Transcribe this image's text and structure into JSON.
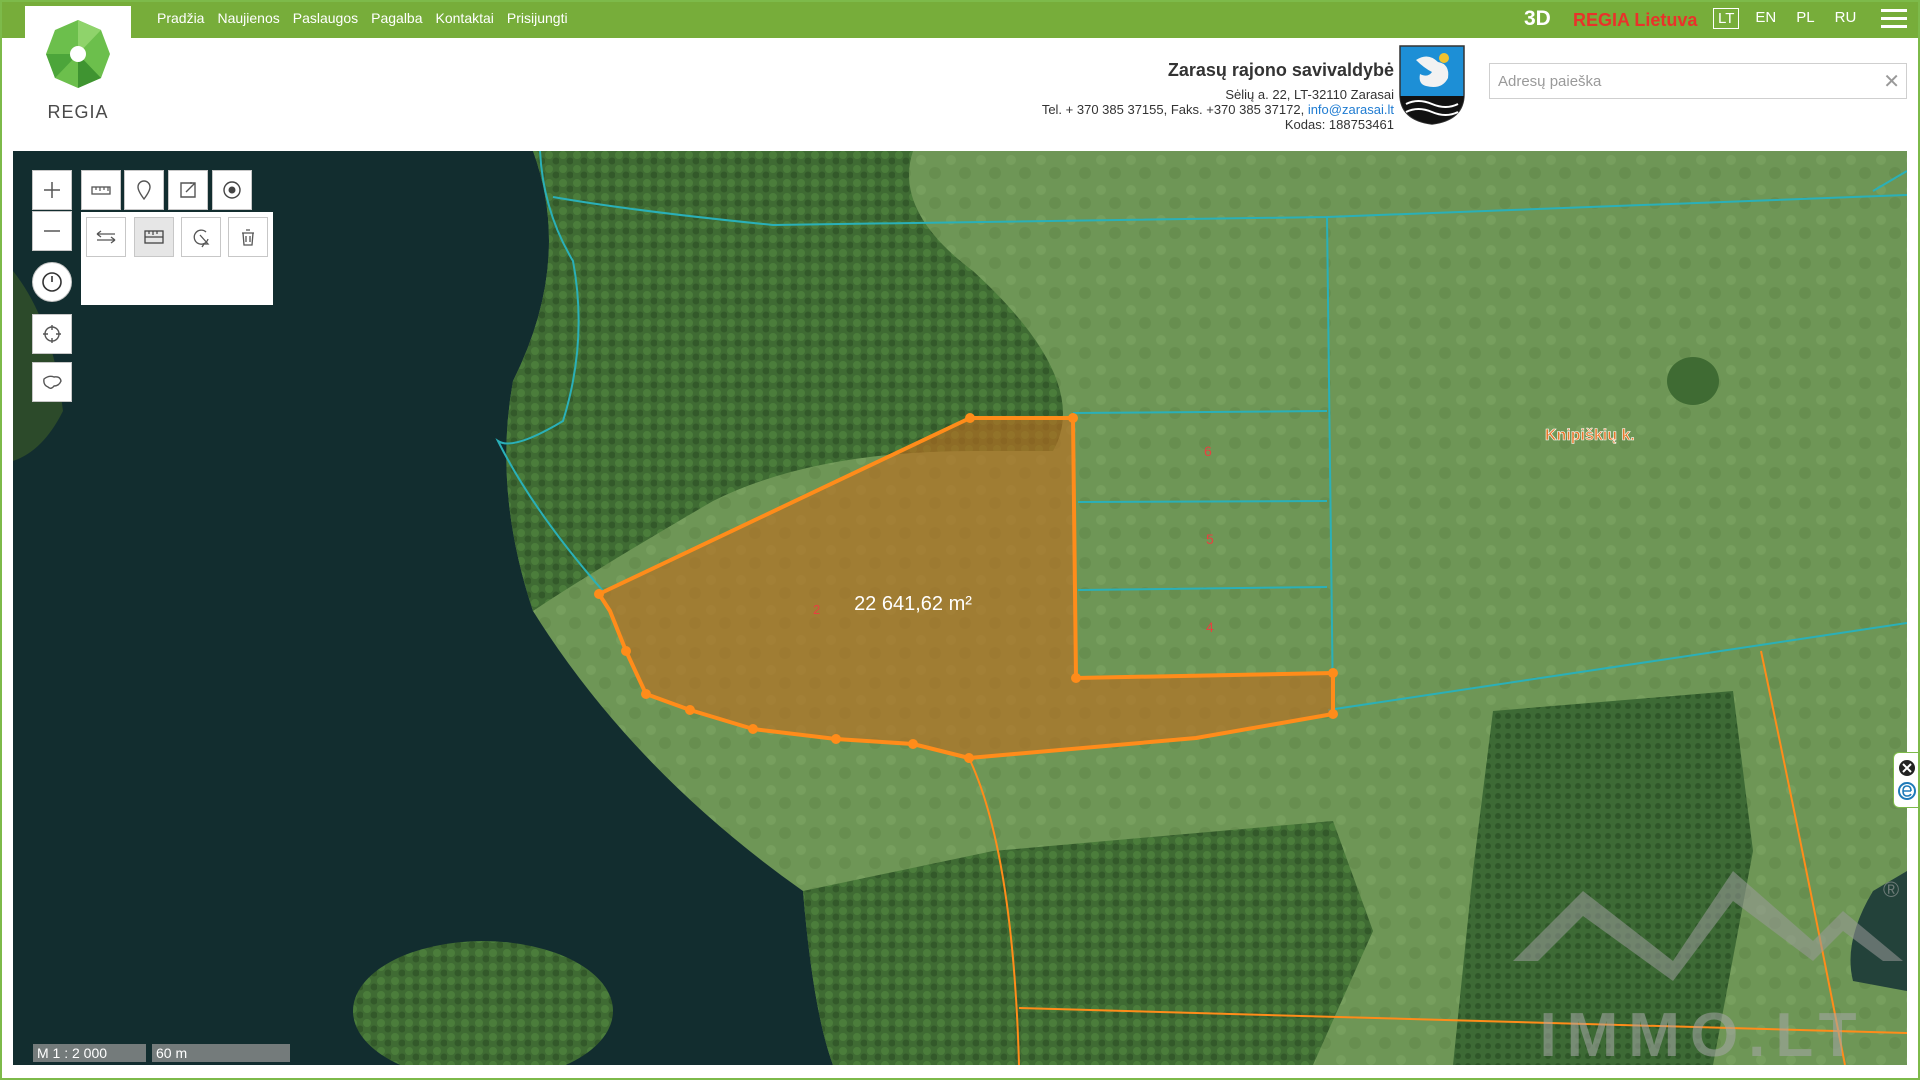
{
  "nav": {
    "items": [
      "Pradžia",
      "Naujienos",
      "Paslaugos",
      "Pagalba",
      "Kontaktai",
      "Prisijungti"
    ],
    "btn_3d": "3D",
    "regia_lietuva": "REGIA Lietuva",
    "langs": [
      "LT",
      "EN",
      "PL",
      "RU"
    ],
    "active_lang": "LT"
  },
  "logo": {
    "text": "REGIA"
  },
  "municipality": {
    "name": "Zarasų rajono savivaldybė",
    "address": "Sėlių a. 22, LT-32110 Zarasai",
    "phone": "Tel. + 370 385 37155, Faks. +370 385 37172,",
    "email": "info@zarasai.lt",
    "code": "Kodas: 188753461"
  },
  "search": {
    "placeholder": "Adresų paieška",
    "value": "",
    "clear": "✕"
  },
  "map": {
    "area_label": "22 641,62 m²",
    "parcel_main_number": "2",
    "parcel_numbers": [
      "6",
      "5",
      "4"
    ],
    "village_label": "Knipiškių k.",
    "watermark": "IMMO.LT",
    "registered_mark": "®",
    "scale_ratio": "M 1 : 2 000",
    "scale_length": "60 m"
  },
  "colors": {
    "header_green": "#77ad3a",
    "parcel_orange": "#ff8c1a",
    "boundary_teal": "#2ab0b8",
    "village_label": "#e7792b"
  },
  "icons": {
    "zoom_in": "plus-icon",
    "zoom_out": "minus-icon",
    "history": "clock-icon",
    "locate": "crosshair-icon",
    "extent": "lithuania-outline-icon",
    "toolbar": [
      "ruler-icon",
      "pin-icon",
      "export-icon",
      "target-icon"
    ],
    "panel": [
      "measure-distance-icon",
      "measure-area-icon",
      "select-icon",
      "trash-icon"
    ]
  }
}
